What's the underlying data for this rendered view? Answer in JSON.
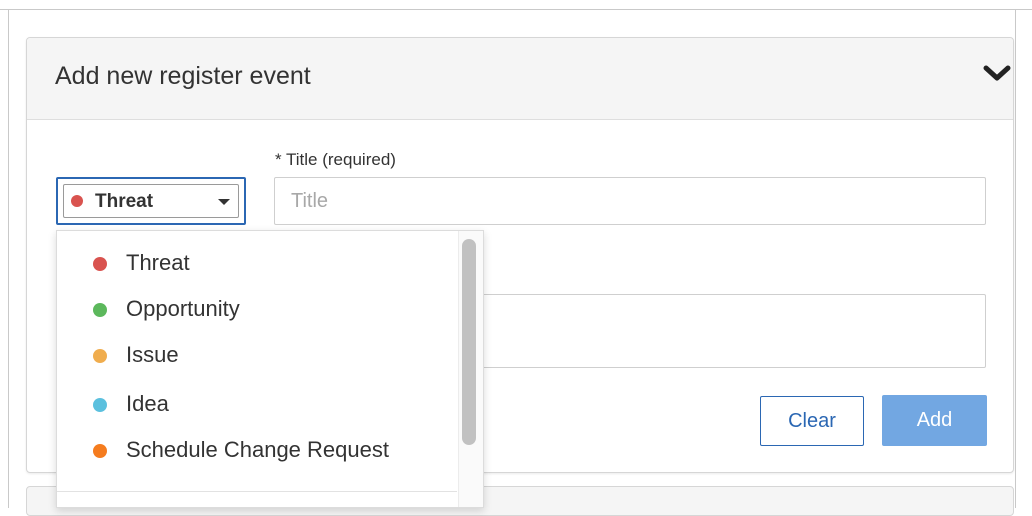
{
  "panel": {
    "title": "Add new register event"
  },
  "form": {
    "title_label": "* Title (required)",
    "title_placeholder": "Title",
    "title_value": ""
  },
  "type_select": {
    "selected_label": "Threat",
    "selected_color": "#d9534f"
  },
  "dropdown": {
    "options": [
      {
        "label": "Threat",
        "color": "#d9534f"
      },
      {
        "label": "Opportunity",
        "color": "#5cb85c"
      },
      {
        "label": "Issue",
        "color": "#f0ad4e"
      },
      {
        "label": "Idea",
        "color": "#5bc0de"
      },
      {
        "label": "Schedule Change Request",
        "color": "#f57c1f"
      }
    ]
  },
  "buttons": {
    "clear_label": "Clear",
    "add_label": "Add"
  },
  "colors": {
    "accent": "#2b67b3",
    "add_button": "#72a7e2"
  },
  "icons": {
    "collapse": "chevron-down-icon"
  }
}
